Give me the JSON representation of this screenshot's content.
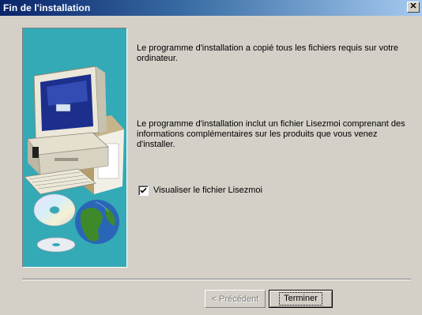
{
  "window": {
    "title": "Fin de l'installation",
    "close_glyph": "✕"
  },
  "illustration": {
    "icon": "computer-with-cds-and-globe-illustration",
    "bg_color": "#33aab6"
  },
  "content": {
    "paragraph1": "Le programme d'installation a copié tous les fichiers requis sur votre ordinateur.",
    "paragraph2": "Le programme d'installation inclut un fichier Lisezmoi comprenant des informations complémentaires sur les produits que vous venez d'installer.",
    "checkbox": {
      "label": "Visualiser le fichier Lisezmoi",
      "checked": true
    }
  },
  "buttons": {
    "previous": "< Précédent",
    "finish": "Terminer"
  },
  "colors": {
    "title_bar_start": "#0a246a",
    "title_bar_end": "#a6caf0",
    "dialog_bg": "#d4d0c8"
  }
}
